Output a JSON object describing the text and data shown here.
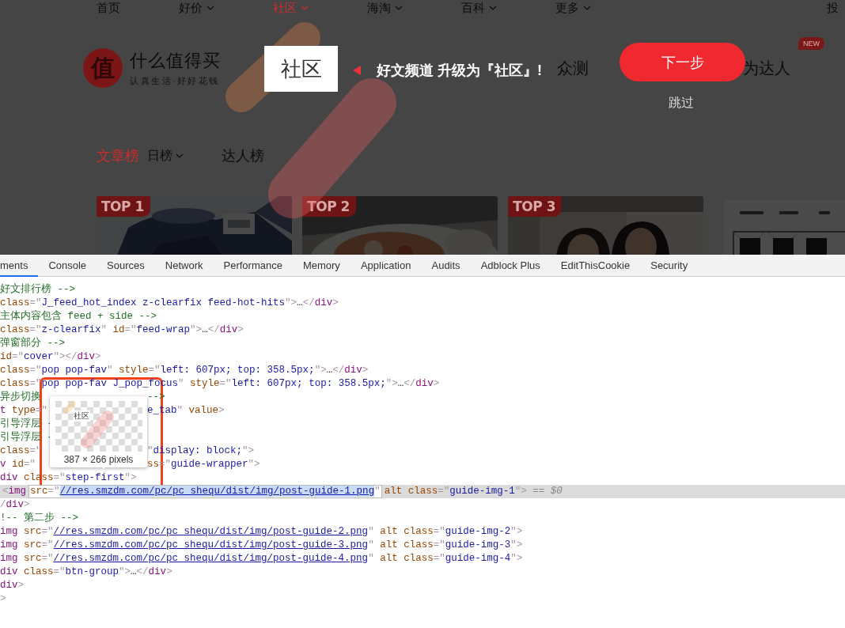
{
  "site": {
    "nav": [
      {
        "label": "首页",
        "selected": false,
        "menu": false
      },
      {
        "label": "好价",
        "selected": false,
        "menu": true
      },
      {
        "label": "社区",
        "selected": true,
        "menu": true
      },
      {
        "label": "海淘",
        "selected": false,
        "menu": true
      },
      {
        "label": "百科",
        "selected": false,
        "menu": true
      },
      {
        "label": "更多",
        "selected": false,
        "menu": true
      },
      {
        "label": "投",
        "selected": false,
        "menu": false
      }
    ],
    "logo": {
      "mark": "值",
      "name": "什么值得买",
      "slogan": "认真生活·好好花钱"
    },
    "channels": [
      {
        "label": "众测"
      },
      {
        "label": "为达人",
        "badge": "NEW"
      }
    ],
    "ranking_tabs": [
      {
        "label": "文章榜",
        "selected": true,
        "menu": false
      },
      {
        "label": "日榜",
        "selected": false,
        "menu": true
      },
      {
        "label": "达人榜",
        "selected": false,
        "menu": false
      }
    ],
    "top_cards": [
      {
        "tag": "TOP 1"
      },
      {
        "tag": "TOP 2"
      },
      {
        "tag": "TOP 3"
      }
    ],
    "guide": {
      "highlight": "社区",
      "message": "好文频道 升级为『社区』!",
      "next_button": "下一步",
      "skip": "跳过"
    }
  },
  "devtools": {
    "tabs": [
      {
        "label": "ments",
        "selected": true
      },
      {
        "label": "Console",
        "selected": false
      },
      {
        "label": "Sources",
        "selected": false
      },
      {
        "label": "Network",
        "selected": false
      },
      {
        "label": "Performance",
        "selected": false
      },
      {
        "label": "Memory",
        "selected": false
      },
      {
        "label": "Application",
        "selected": false
      },
      {
        "label": "Audits",
        "selected": false
      },
      {
        "label": "Adblock Plus",
        "selected": false
      },
      {
        "label": "EditThisCookie",
        "selected": false
      },
      {
        "label": "Security",
        "selected": false
      }
    ],
    "lines": [
      {
        "selected": false,
        "parts": [
          {
            "kind": "code",
            "spans": [
              {
                "kind": "comment",
                "text": "好文排行榜 -->"
              }
            ]
          }
        ]
      },
      {
        "selected": false,
        "parts": [
          {
            "kind": "code",
            "spans": [
              {
                "kind": "attr",
                "text": "class"
              },
              {
                "kind": "punct",
                "text": "=\""
              },
              {
                "kind": "value",
                "text": "J_feed_hot_index z-clearfix feed-hot-hits"
              },
              {
                "kind": "punct",
                "text": "\">"
              },
              {
                "kind": "text",
                "text": "…"
              },
              {
                "kind": "punct",
                "text": "</"
              },
              {
                "kind": "tag",
                "text": "div"
              },
              {
                "kind": "punct",
                "text": ">"
              }
            ]
          }
        ]
      },
      {
        "selected": false,
        "parts": [
          {
            "kind": "code",
            "spans": [
              {
                "kind": "comment",
                "text": "主体内容包含 feed + side -->"
              }
            ]
          }
        ]
      },
      {
        "selected": false,
        "parts": [
          {
            "kind": "code",
            "spans": [
              {
                "kind": "attr",
                "text": "class"
              },
              {
                "kind": "punct",
                "text": "=\""
              },
              {
                "kind": "value",
                "text": "z-clearfix"
              },
              {
                "kind": "punct",
                "text": "\""
              },
              {
                "kind": "attr",
                "text": " id"
              },
              {
                "kind": "punct",
                "text": "=\""
              },
              {
                "kind": "value",
                "text": "feed-wrap"
              },
              {
                "kind": "punct",
                "text": "\">"
              },
              {
                "kind": "text",
                "text": "…"
              },
              {
                "kind": "punct",
                "text": "</"
              },
              {
                "kind": "tag",
                "text": "div"
              },
              {
                "kind": "punct",
                "text": ">"
              }
            ]
          }
        ]
      },
      {
        "selected": false,
        "parts": [
          {
            "kind": "code",
            "spans": [
              {
                "kind": "comment",
                "text": "弹窗部分 -->"
              }
            ]
          }
        ]
      },
      {
        "selected": false,
        "parts": [
          {
            "kind": "code",
            "spans": [
              {
                "kind": "attr",
                "text": "id"
              },
              {
                "kind": "punct",
                "text": "=\""
              },
              {
                "kind": "value",
                "text": "cover"
              },
              {
                "kind": "punct",
                "text": "\"></"
              },
              {
                "kind": "tag",
                "text": "div"
              },
              {
                "kind": "punct",
                "text": ">"
              }
            ]
          }
        ]
      },
      {
        "selected": false,
        "parts": [
          {
            "kind": "code",
            "spans": [
              {
                "kind": "attr",
                "text": "class"
              },
              {
                "kind": "punct",
                "text": "=\""
              },
              {
                "kind": "value",
                "text": "pop pop-fav"
              },
              {
                "kind": "punct",
                "text": "\""
              },
              {
                "kind": "attr",
                "text": " style"
              },
              {
                "kind": "punct",
                "text": "=\""
              },
              {
                "kind": "value",
                "text": "left: 607px; top: 358.5px;"
              },
              {
                "kind": "punct",
                "text": "\">"
              },
              {
                "kind": "text",
                "text": "…"
              },
              {
                "kind": "punct",
                "text": "</"
              },
              {
                "kind": "tag",
                "text": "div"
              },
              {
                "kind": "punct",
                "text": ">"
              }
            ]
          }
        ]
      },
      {
        "selected": false,
        "parts": [
          {
            "kind": "code",
            "spans": [
              {
                "kind": "attr",
                "text": "class"
              },
              {
                "kind": "punct",
                "text": "=\""
              },
              {
                "kind": "value",
                "text": "pop pop-fav J_pop_focus"
              },
              {
                "kind": "punct",
                "text": "\""
              },
              {
                "kind": "attr",
                "text": " style"
              },
              {
                "kind": "punct",
                "text": "=\""
              },
              {
                "kind": "value",
                "text": "left: 607px; top: 358.5px;"
              },
              {
                "kind": "punct",
                "text": "\">"
              },
              {
                "kind": "text",
                "text": "…"
              },
              {
                "kind": "punct",
                "text": "</"
              },
              {
                "kind": "tag",
                "text": "div"
              },
              {
                "kind": "punct",
                "text": ">"
              }
            ]
          }
        ]
      },
      {
        "selected": false,
        "parts": [
          {
            "kind": "code",
            "spans": [
              {
                "kind": "comment",
                "text": "异步切换"
              }
            ]
          },
          {
            "kind": "gap"
          },
          {
            "kind": "code",
            "spans": [
              {
                "kind": "comment",
                "text": "-->"
              }
            ]
          }
        ]
      },
      {
        "selected": false,
        "parts": [
          {
            "kind": "code",
            "spans": [
              {
                "kind": "tag",
                "text": "t"
              },
              {
                "kind": "attr",
                "text": " type"
              },
              {
                "kind": "punct",
                "text": "=\""
              }
            ]
          },
          {
            "kind": "gap"
          },
          {
            "kind": "code",
            "spans": [
              {
                "kind": "value",
                "text": "e_tab"
              },
              {
                "kind": "punct",
                "text": "\""
              },
              {
                "kind": "attr",
                "text": " value"
              },
              {
                "kind": "punct",
                "text": ">"
              }
            ]
          }
        ]
      },
      {
        "selected": false,
        "parts": [
          {
            "kind": "code",
            "spans": [
              {
                "kind": "comment",
                "text": "引导浮层 -"
              }
            ]
          }
        ]
      },
      {
        "selected": false,
        "parts": [
          {
            "kind": "code",
            "spans": [
              {
                "kind": "comment",
                "text": "引导浮层 -"
              }
            ]
          }
        ]
      },
      {
        "selected": false,
        "parts": [
          {
            "kind": "code",
            "spans": [
              {
                "kind": "attr",
                "text": "class"
              },
              {
                "kind": "punct",
                "text": "=\""
              }
            ]
          },
          {
            "kind": "gap"
          },
          {
            "kind": "code",
            "spans": [
              {
                "kind": "punct",
                "text": "\""
              },
              {
                "kind": "value",
                "text": "display: block;"
              },
              {
                "kind": "punct",
                "text": "\">"
              }
            ]
          }
        ]
      },
      {
        "selected": false,
        "parts": [
          {
            "kind": "code",
            "spans": [
              {
                "kind": "tag",
                "text": "v"
              },
              {
                "kind": "attr",
                "text": " id"
              },
              {
                "kind": "punct",
                "text": "=\""
              }
            ]
          },
          {
            "kind": "gap"
          },
          {
            "kind": "code",
            "spans": [
              {
                "kind": "attr",
                "text": "ss"
              },
              {
                "kind": "punct",
                "text": "=\""
              },
              {
                "kind": "value",
                "text": "guide-wrapper"
              },
              {
                "kind": "punct",
                "text": "\">"
              }
            ]
          }
        ]
      },
      {
        "selected": false,
        "parts": [
          {
            "kind": "code",
            "spans": [
              {
                "kind": "tag",
                "text": "div"
              },
              {
                "kind": "attr",
                "text": " class"
              },
              {
                "kind": "punct",
                "text": "=\""
              },
              {
                "kind": "value",
                "text": "step-first"
              },
              {
                "kind": "punct",
                "text": "\">"
              }
            ]
          }
        ]
      },
      {
        "selected": true,
        "parts": [
          {
            "kind": "code",
            "spans": [
              {
                "kind": "punct",
                "text": "<"
              },
              {
                "kind": "tag",
                "text": "img"
              }
            ]
          },
          {
            "kind": "edit",
            "spans": [
              {
                "kind": "attr",
                "text": "src"
              },
              {
                "kind": "punct",
                "text": "=\""
              },
              {
                "kind": "selected_link",
                "text": "//res.smzdm.com/pc/pc_shequ/dist/img/post-guide-1.png"
              },
              {
                "kind": "punct",
                "text": "\""
              }
            ]
          },
          {
            "kind": "code",
            "spans": [
              {
                "kind": "attr",
                "text": "alt"
              },
              {
                "kind": "attr",
                "text": " class"
              },
              {
                "kind": "punct",
                "text": "=\""
              },
              {
                "kind": "value",
                "text": "guide-img-1"
              },
              {
                "kind": "punct",
                "text": "\">"
              },
              {
                "kind": "meta",
                "text": " == $0"
              }
            ]
          }
        ]
      },
      {
        "selected": false,
        "parts": [
          {
            "kind": "code",
            "spans": [
              {
                "kind": "punct",
                "text": "/"
              },
              {
                "kind": "tag",
                "text": "div"
              },
              {
                "kind": "punct",
                "text": ">"
              }
            ]
          }
        ]
      },
      {
        "selected": false,
        "parts": [
          {
            "kind": "code",
            "spans": [
              {
                "kind": "comment",
                "text": "!-- 第二步 -->"
              }
            ]
          }
        ]
      },
      {
        "selected": false,
        "parts": [
          {
            "kind": "code",
            "spans": [
              {
                "kind": "tag",
                "text": "img"
              },
              {
                "kind": "attr",
                "text": " src"
              },
              {
                "kind": "punct",
                "text": "=\""
              },
              {
                "kind": "link",
                "text": "//res.smzdm.com/pc/pc_shequ/dist/img/post-guide-2.png"
              },
              {
                "kind": "punct",
                "text": "\""
              },
              {
                "kind": "attr",
                "text": " alt"
              },
              {
                "kind": "attr",
                "text": " class"
              },
              {
                "kind": "punct",
                "text": "=\""
              },
              {
                "kind": "value",
                "text": "guide-img-2"
              },
              {
                "kind": "punct",
                "text": "\">"
              }
            ]
          }
        ]
      },
      {
        "selected": false,
        "parts": [
          {
            "kind": "code",
            "spans": [
              {
                "kind": "tag",
                "text": "img"
              },
              {
                "kind": "attr",
                "text": " src"
              },
              {
                "kind": "punct",
                "text": "=\""
              },
              {
                "kind": "link",
                "text": "//res.smzdm.com/pc/pc_shequ/dist/img/post-guide-3.png"
              },
              {
                "kind": "punct",
                "text": "\""
              },
              {
                "kind": "attr",
                "text": " alt"
              },
              {
                "kind": "attr",
                "text": " class"
              },
              {
                "kind": "punct",
                "text": "=\""
              },
              {
                "kind": "value",
                "text": "guide-img-3"
              },
              {
                "kind": "punct",
                "text": "\">"
              }
            ]
          }
        ]
      },
      {
        "selected": false,
        "parts": [
          {
            "kind": "code",
            "spans": [
              {
                "kind": "tag",
                "text": "img"
              },
              {
                "kind": "attr",
                "text": " src"
              },
              {
                "kind": "punct",
                "text": "=\""
              },
              {
                "kind": "link",
                "text": "//res.smzdm.com/pc/pc_shequ/dist/img/post-guide-4.png"
              },
              {
                "kind": "punct",
                "text": "\""
              },
              {
                "kind": "attr",
                "text": " alt"
              },
              {
                "kind": "attr",
                "text": " class"
              },
              {
                "kind": "punct",
                "text": "=\""
              },
              {
                "kind": "value",
                "text": "guide-img-4"
              },
              {
                "kind": "punct",
                "text": "\">"
              }
            ]
          }
        ]
      },
      {
        "selected": false,
        "parts": [
          {
            "kind": "code",
            "spans": [
              {
                "kind": "tag",
                "text": "div"
              },
              {
                "kind": "attr",
                "text": " class"
              },
              {
                "kind": "punct",
                "text": "=\""
              },
              {
                "kind": "value",
                "text": "btn-group"
              },
              {
                "kind": "punct",
                "text": "\">"
              },
              {
                "kind": "text",
                "text": "…"
              },
              {
                "kind": "punct",
                "text": "</"
              },
              {
                "kind": "tag",
                "text": "div"
              },
              {
                "kind": "punct",
                "text": ">"
              }
            ]
          }
        ]
      },
      {
        "selected": false,
        "parts": [
          {
            "kind": "code",
            "spans": [
              {
                "kind": "tag",
                "text": "div"
              },
              {
                "kind": "punct",
                "text": ">"
              }
            ]
          }
        ]
      },
      {
        "selected": false,
        "parts": [
          {
            "kind": "code",
            "spans": [
              {
                "kind": "punct",
                "text": ">"
              }
            ]
          }
        ]
      }
    ],
    "tooltip": {
      "preview_label": "社区",
      "size": "387 × 266 pixels"
    }
  }
}
